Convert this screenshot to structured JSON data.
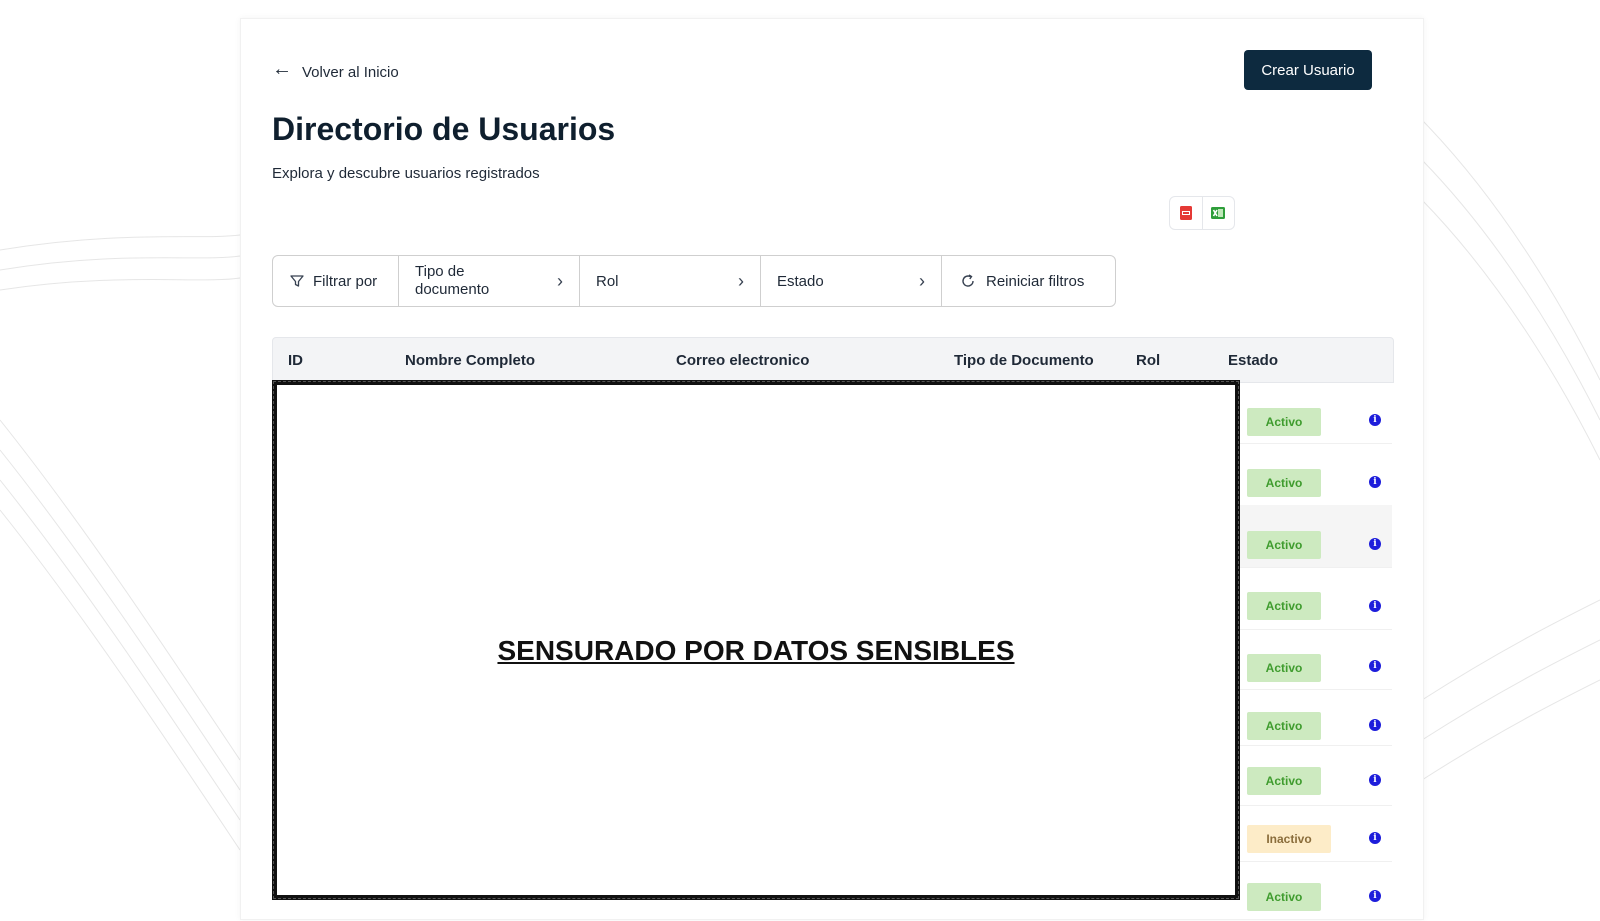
{
  "nav": {
    "back_label": "Volver al Inicio",
    "create_label": "Crear Usuario"
  },
  "page": {
    "title": "Directorio de Usuarios",
    "subtitle": "Explora y descubre usuarios registrados"
  },
  "export": {
    "pdf_icon": "pdf-icon",
    "excel_icon": "excel-icon"
  },
  "filters": {
    "label": "Filtrar por",
    "doc_type_line1": "Tipo de",
    "doc_type_line2": "documento",
    "role": "Rol",
    "status": "Estado",
    "reset": "Reiniciar filtros"
  },
  "table": {
    "columns": [
      "ID",
      "Nombre Completo",
      "Correo electronico",
      "Tipo de Documento",
      "Rol",
      "Estado"
    ],
    "rows": [
      {
        "status": "Activo"
      },
      {
        "status": "Activo"
      },
      {
        "status": "Activo"
      },
      {
        "status": "Activo"
      },
      {
        "status": "Activo"
      },
      {
        "status": "Activo"
      },
      {
        "status": "Activo"
      },
      {
        "status": "Inactivo"
      },
      {
        "status": "Activo"
      }
    ]
  },
  "censor": {
    "text": "SENSURADO POR DATOS SENSIBLES"
  },
  "colors": {
    "primary": "#0d2a3f",
    "active_bg": "#cdeac0",
    "inactive_bg": "#fdecc8",
    "info": "#1d1ddb"
  }
}
